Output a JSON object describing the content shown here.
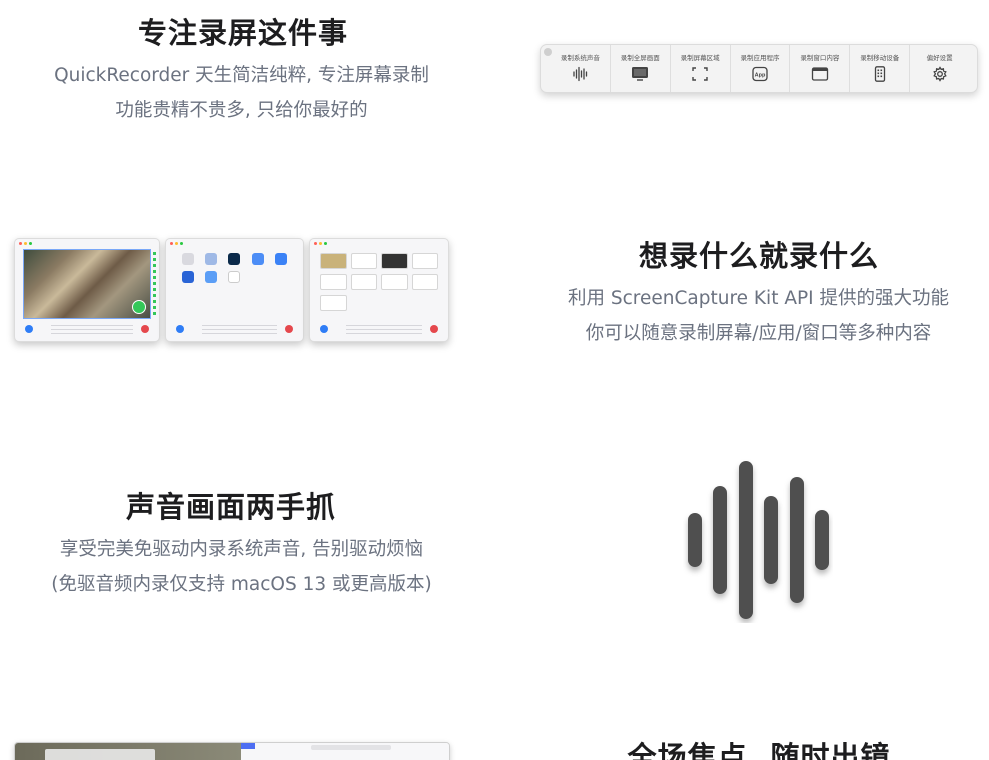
{
  "sections": [
    {
      "title": "专注录屏这件事",
      "desc_lines": [
        "QuickRecorder 天生简洁纯粹, 专注屏幕录制",
        "功能贵精不贵多, 只给你最好的"
      ]
    },
    {
      "title": "想录什么就录什么",
      "desc_lines": [
        "利用 ScreenCapture Kit API 提供的强大功能",
        "你可以随意录制屏幕/应用/窗口等多种内容"
      ]
    },
    {
      "title": "声音画面两手抓",
      "desc_lines": [
        "享受完美免驱动内录系统声音, 告别驱动烦恼",
        "(免驱音频内录仅支持 macOS 13 或更高版本)"
      ]
    },
    {
      "title": "全场焦点, 随时出镜",
      "desc_lines": []
    }
  ],
  "toolbar": {
    "items": [
      {
        "label": "录制系统声音",
        "icon": "waveform-icon"
      },
      {
        "label": "录制全屏画面",
        "icon": "display-icon"
      },
      {
        "label": "录制屏幕区域",
        "icon": "selection-icon"
      },
      {
        "label": "录制应用程序",
        "icon": "app-icon",
        "icon_text": "App"
      },
      {
        "label": "录制窗口内容",
        "icon": "window-icon"
      },
      {
        "label": "录制移动设备",
        "icon": "mobile-icon"
      },
      {
        "label": "偏好设置",
        "icon": "gear-icon"
      }
    ]
  },
  "colors": {
    "title": "#1d1d1f",
    "desc": "#6b7280",
    "wave": "#4f4f4f",
    "accent_blue": "#2f7df6",
    "stop_red": "#e5484d",
    "check_green": "#34c759"
  }
}
